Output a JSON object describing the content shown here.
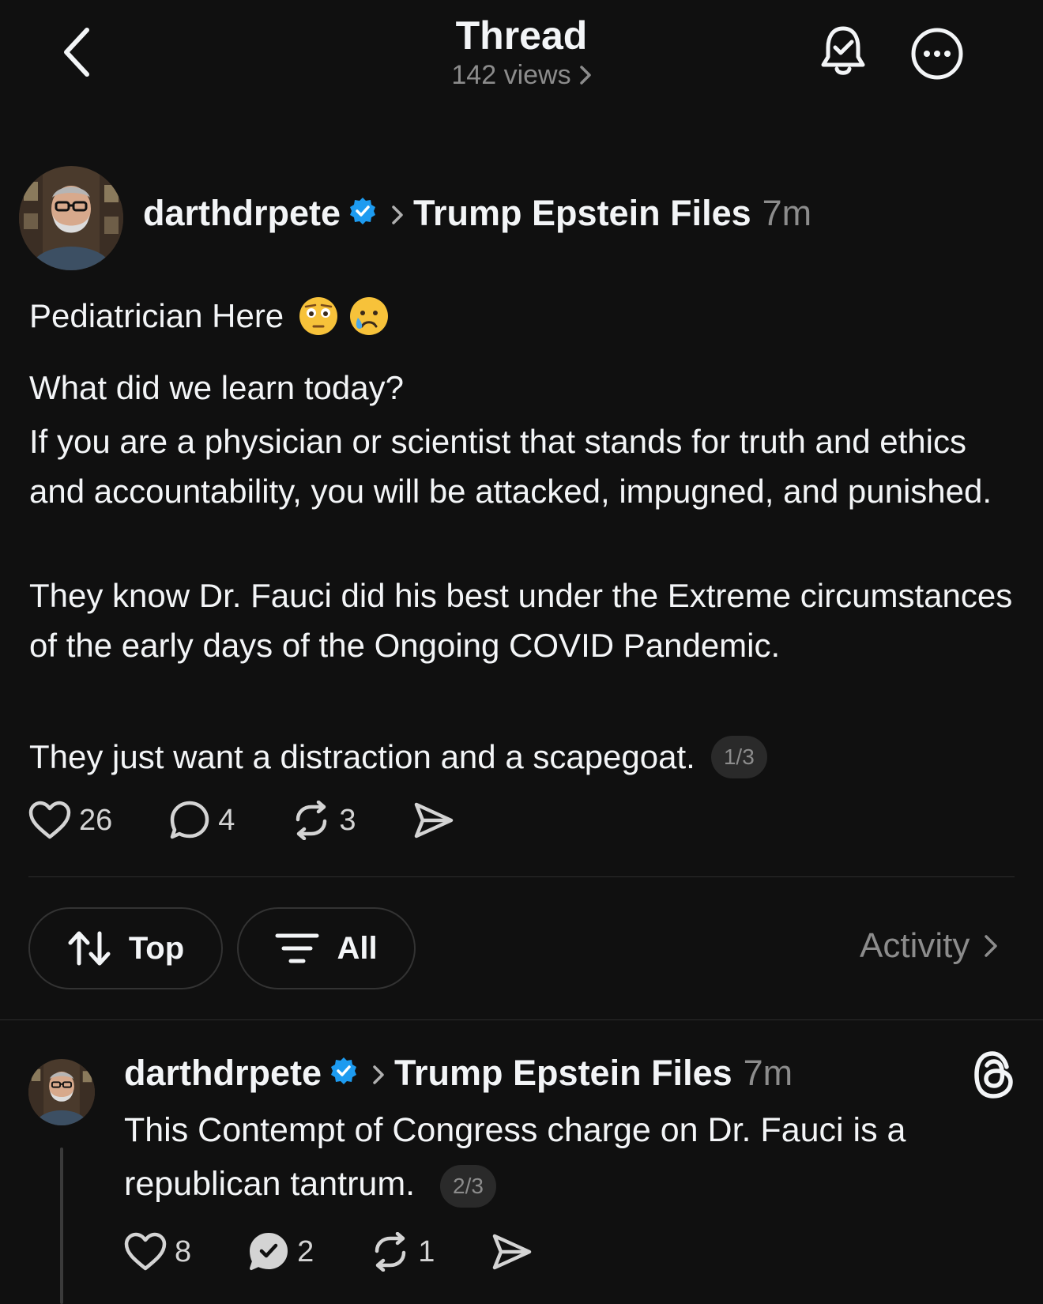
{
  "header": {
    "title": "Thread",
    "views": "142 views"
  },
  "post1": {
    "username": "darthdrpete",
    "topic": "Trump Epstein Files",
    "time": "7m",
    "first_line": "Pediatrician Here",
    "paragraphs": [
      "What did we learn today?",
      "If you are a physician or scientist that stands for truth and ethics and accountability, you will be attacked, impugned, and punished.",
      "They know Dr. Fauci did his best under the Extreme circumstances of the early days of the Ongoing COVID Pandemic.",
      "They just want a distraction and a scapegoat."
    ],
    "counter": "1/3",
    "likes": "26",
    "replies": "4",
    "reposts": "3"
  },
  "filters": {
    "sort_label": "Top",
    "filter_label": "All",
    "activity_label": "Activity"
  },
  "post2": {
    "username": "darthdrpete",
    "topic": "Trump Epstein Files",
    "time": "7m",
    "text": "This Contempt of Congress charge on Dr. Fauci is a republican tantrum.",
    "counter": "2/3",
    "likes": "8",
    "replies": "2",
    "reposts": "1"
  },
  "colors": {
    "background": "#101010",
    "text": "#f3f5f7",
    "secondary": "#8c8c8c",
    "verified": "#1d9bf0"
  }
}
